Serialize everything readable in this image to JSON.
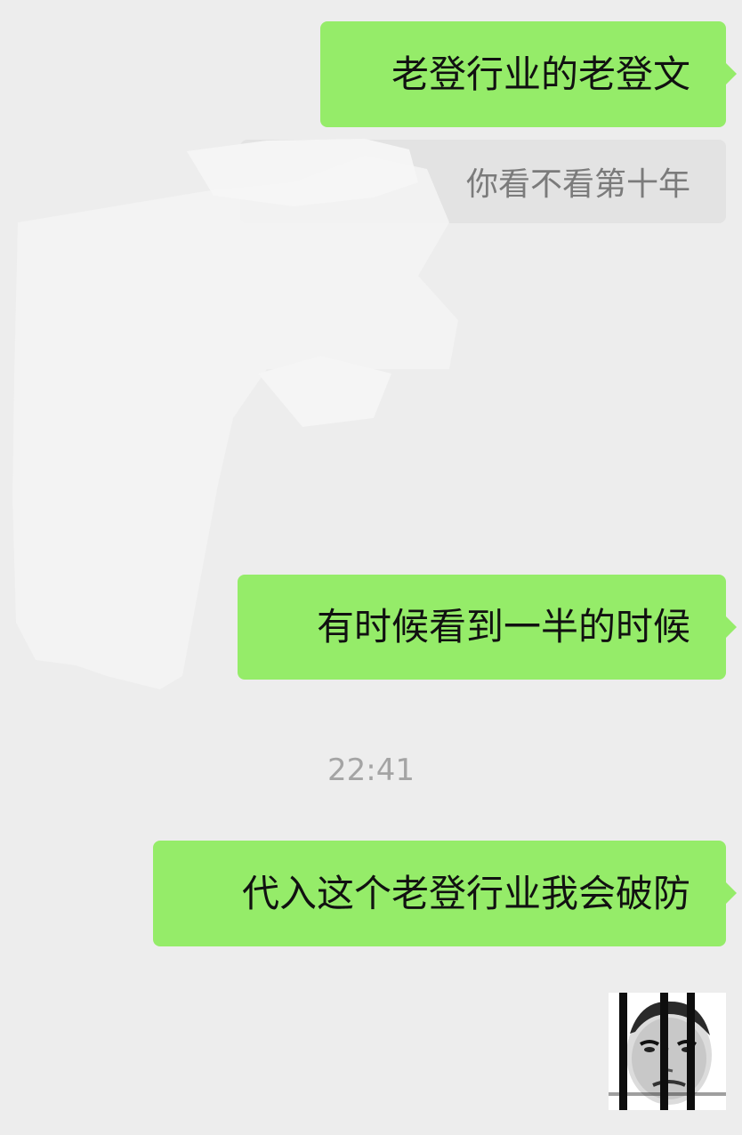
{
  "chat": {
    "messages": [
      {
        "type": "sent",
        "text": "老登行业的老登文"
      },
      {
        "type": "quote",
        "text": "你看不看第十年"
      },
      {
        "type": "sent",
        "text": "有时候看到一半的时候"
      },
      {
        "type": "timestamp",
        "text": "22:41"
      },
      {
        "type": "sent",
        "text": "代入这个老登行业我会破防"
      },
      {
        "type": "sticker",
        "icon": "crying-face-behind-bars-icon"
      }
    ]
  },
  "colors": {
    "background": "#ededed",
    "sent_bubble": "#95ec69",
    "quote_bubble": "#e3e3e3",
    "quote_text": "#7b7b7b",
    "timestamp_text": "#a4a4a4"
  }
}
